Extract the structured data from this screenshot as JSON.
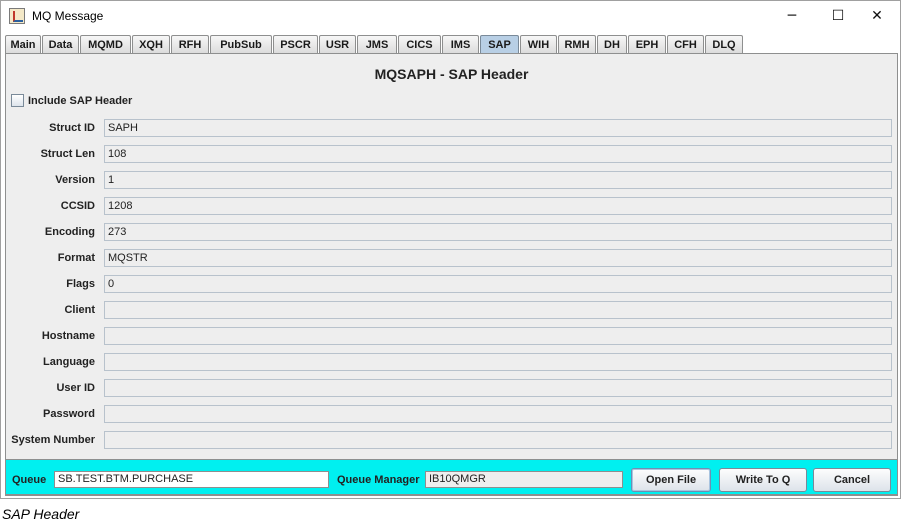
{
  "window": {
    "title": "MQ Message",
    "minimize_glyph": "─",
    "maximize_glyph": "☐",
    "close_glyph": "✕"
  },
  "tabs": [
    "Main",
    "Data",
    "MQMD",
    "XQH",
    "RFH",
    "PubSub",
    "PSCR",
    "USR",
    "JMS",
    "CICS",
    "IMS",
    "SAP",
    "WIH",
    "RMH",
    "DH",
    "EPH",
    "CFH",
    "DLQ"
  ],
  "active_tab": "SAP",
  "panel": {
    "title": "MQSAPH - SAP Header",
    "include_label": "Include SAP Header",
    "include_checked": false,
    "fields": [
      {
        "label": "Struct ID",
        "value": "SAPH"
      },
      {
        "label": "Struct Len",
        "value": "108"
      },
      {
        "label": "Version",
        "value": "1"
      },
      {
        "label": "CCSID",
        "value": "1208"
      },
      {
        "label": "Encoding",
        "value": "273"
      },
      {
        "label": "Format",
        "value": "MQSTR"
      },
      {
        "label": "Flags",
        "value": "0"
      },
      {
        "label": "Client",
        "value": ""
      },
      {
        "label": "Hostname",
        "value": ""
      },
      {
        "label": "Language",
        "value": ""
      },
      {
        "label": "User ID",
        "value": ""
      },
      {
        "label": "Password",
        "value": ""
      },
      {
        "label": "System Number",
        "value": ""
      }
    ]
  },
  "bottom": {
    "queue_label": "Queue",
    "queue_value": "SB.TEST.BTM.PURCHASE",
    "qmgr_label": "Queue Manager",
    "qmgr_value": "IB10QMGR",
    "open_file": "Open File",
    "write_to_q": "Write To Q",
    "cancel": "Cancel",
    "accent_color": "#00f0f0"
  },
  "caption": "SAP Header"
}
